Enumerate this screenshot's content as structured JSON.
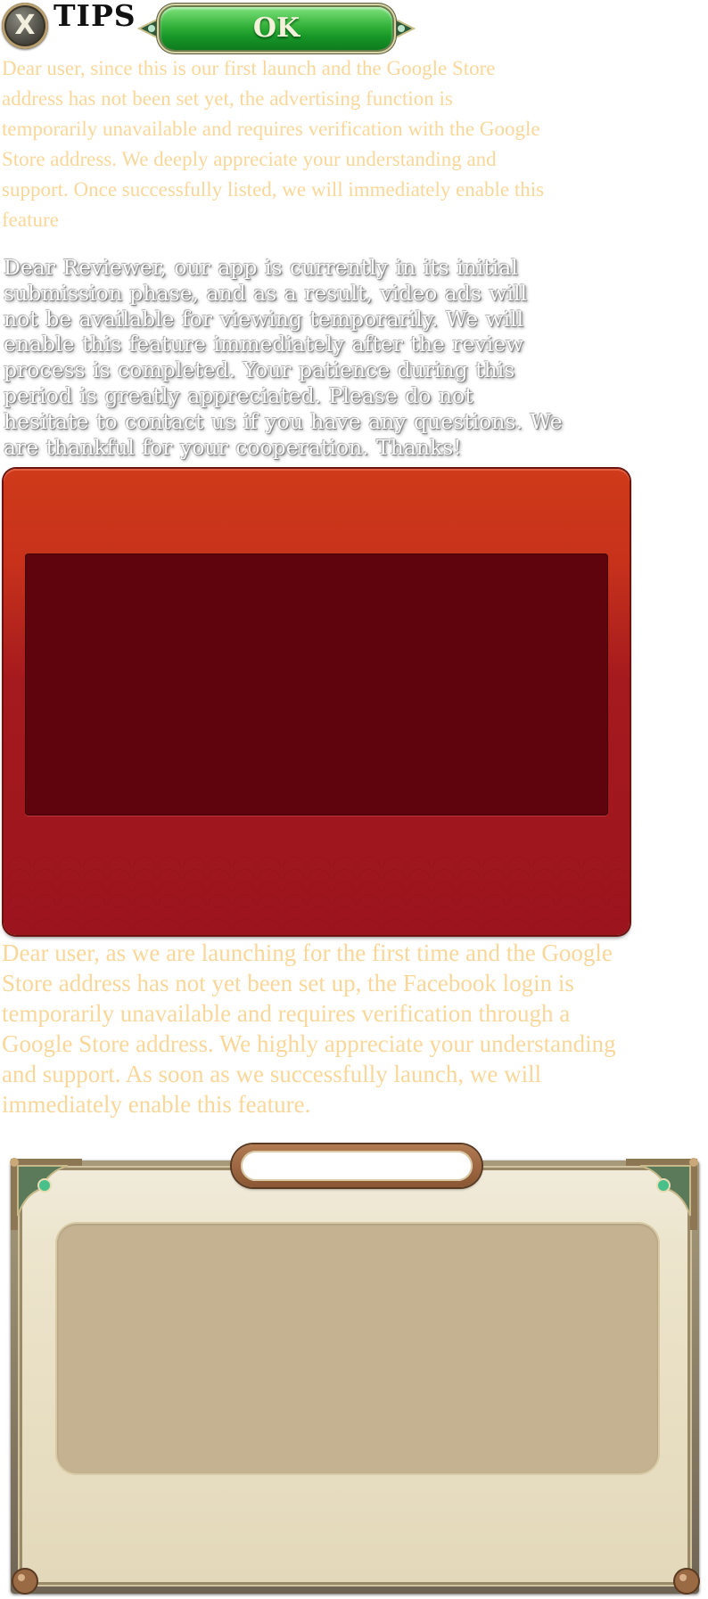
{
  "header": {
    "close_icon_glyph": "X",
    "title": "TIPS",
    "ok_label": "OK"
  },
  "notices": {
    "advertising": "Dear user, since this is our first launch and the Google Store address has not been set yet, the advertising function is temporarily unavailable and requires verification with the Google Store address. We deeply appreciate your understanding and support. Once successfully listed, we will immediately enable this feature",
    "reviewer": "Dear Reviewer, our app is currently in its initial submission phase, and as a result, video ads will not be available for viewing temporarily. We will enable this feature immediately after the review process is completed. Your patience during this period is greatly appreciated. Please do not hesitate to contact us if you have any questions. We are thankful for your cooperation. Thanks!",
    "facebook": "Dear user, as we are launching for the first time and the Google Store address has not yet been set up, the Facebook login is temporarily unavailable and requires verification through a Google Store address. We highly appreciate your understanding and support. As soon as we successfully launch, we will immediately enable this feature."
  },
  "colors": {
    "notice_text": "#f9d79a",
    "ok_green": "#1e9a2c",
    "red_panel": "#b4221c",
    "red_inner": "#5f030d",
    "frame_cream": "#ece4cc",
    "frame_inner": "#c4b290"
  },
  "icons": {
    "close": "close-icon",
    "ok_wings": "ornament-wing-icon",
    "corner": "corner-ornament-icon"
  }
}
